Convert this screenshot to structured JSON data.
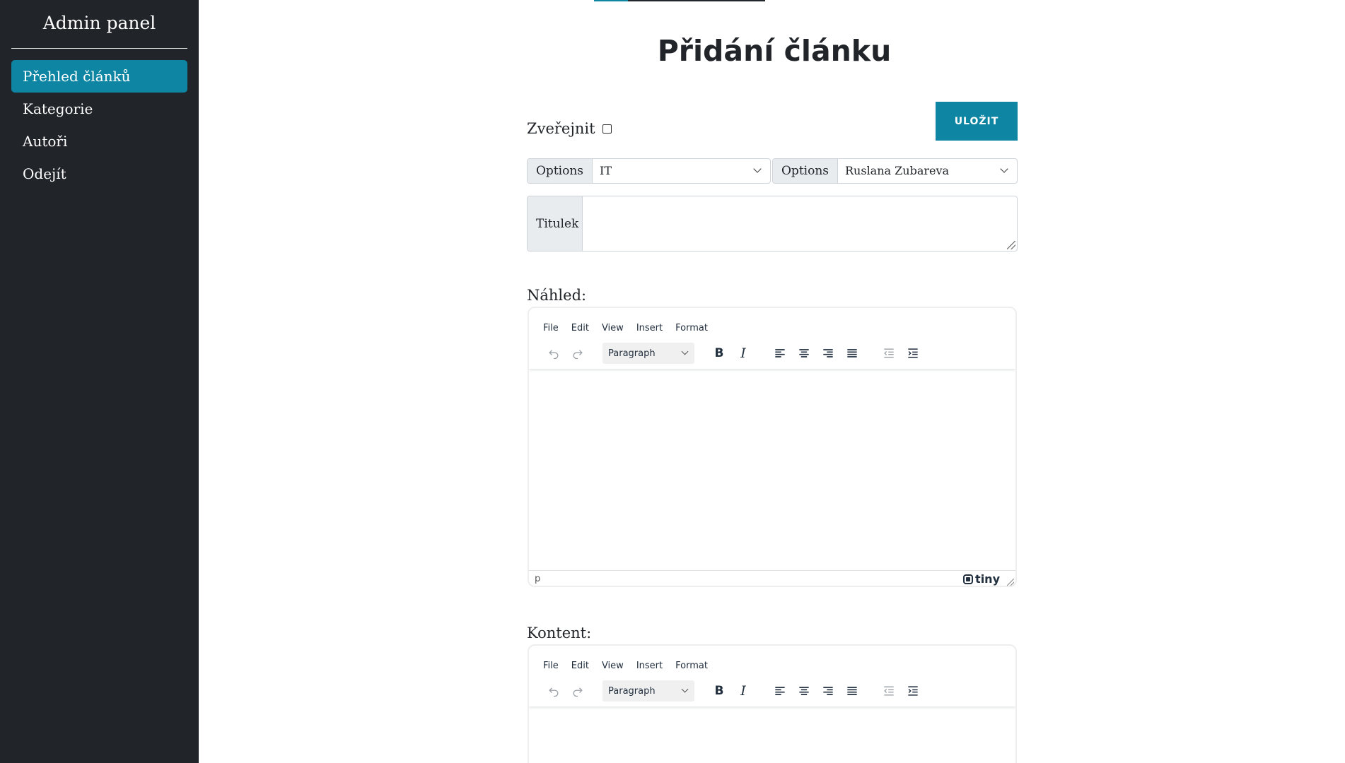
{
  "sidebar": {
    "brand": "Admin panel",
    "items": [
      {
        "label": "Přehled článků",
        "active": true
      },
      {
        "label": "Kategorie",
        "active": false
      },
      {
        "label": "Autoři",
        "active": false
      },
      {
        "label": "Odejít",
        "active": false
      }
    ]
  },
  "page": {
    "title": "Přidání článku",
    "publish_label": "Zveřejnit",
    "publish_checked": false,
    "save_label": "ULOŽIT"
  },
  "selects": {
    "category": {
      "label": "Options",
      "value": "IT"
    },
    "author": {
      "label": "Options",
      "value": "Ruslana Zubareva"
    }
  },
  "title_field": {
    "label": "Titulek",
    "value": ""
  },
  "preview": {
    "label": "Náhled:",
    "menu": [
      "File",
      "Edit",
      "View",
      "Insert",
      "Format"
    ],
    "block_format": "Paragraph",
    "status_path": "p",
    "brand": "tiny"
  },
  "content": {
    "label": "Kontent:",
    "menu": [
      "File",
      "Edit",
      "View",
      "Insert",
      "Format"
    ],
    "block_format": "Paragraph"
  },
  "colors": {
    "sidebar_bg": "#212529",
    "accent": "#0e86a3"
  }
}
